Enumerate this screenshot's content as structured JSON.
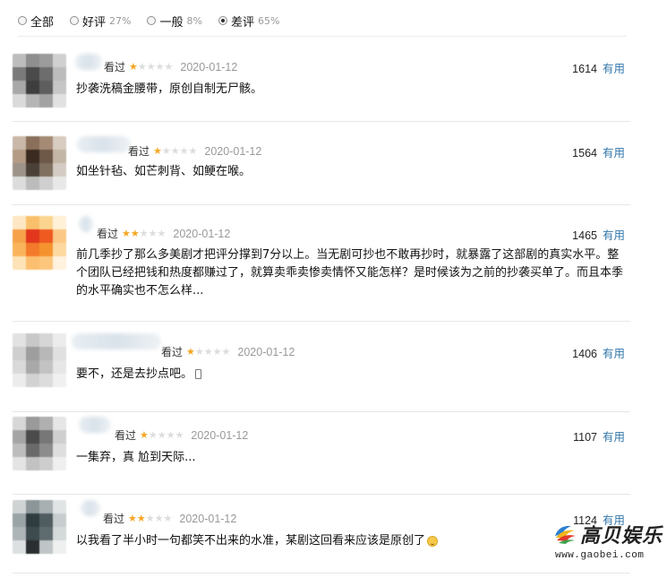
{
  "filters": [
    {
      "label": "全部",
      "pct": "",
      "checked": false
    },
    {
      "label": "好评",
      "pct": "27%",
      "checked": false
    },
    {
      "label": "一般",
      "pct": "8%",
      "checked": false
    },
    {
      "label": "差评",
      "pct": "65%",
      "checked": true
    }
  ],
  "comments": [
    {
      "watched": "看过",
      "stars": 1,
      "date": "2020-01-12",
      "votes": "1614",
      "useful": "有用",
      "text": "抄袭洗稿金腰带，原创自制无尸骸。"
    },
    {
      "watched": "看过",
      "stars": 1,
      "date": "2020-01-12",
      "votes": "1564",
      "useful": "有用",
      "text": "如坐针毡、如芒刺背、如鲠在喉。"
    },
    {
      "watched": "看过",
      "stars": 2,
      "date": "2020-01-12",
      "votes": "1465",
      "useful": "有用",
      "text": "前几季抄了那么多美剧才把评分撑到7分以上。当无剧可抄也不敢再抄时，就暴露了这部剧的真实水平。整个团队已经把钱和热度都赚过了，就算卖乖卖惨卖情怀又能怎样？是时候该为之前的抄袭买单了。而且本季的水平确实也不怎么样..."
    },
    {
      "watched": "看过",
      "stars": 1,
      "date": "2020-01-12",
      "votes": "1406",
      "useful": "有用",
      "text": "要不，还是去抄点吧。",
      "icon": "phone-icon"
    },
    {
      "watched": "看过",
      "stars": 1,
      "date": "2020-01-12",
      "votes": "1107",
      "useful": "有用",
      "text": "一集弃，真 尬到天际..."
    },
    {
      "watched": "看过",
      "stars": 2,
      "date": "2020-01-12",
      "votes": "1124",
      "useful": "有用",
      "text": "以我看了半小时一句都笑不出来的水准，某剧这回看来应该是原创了",
      "icon": "emoji-icon"
    }
  ],
  "watermark": {
    "title": "高贝娱乐",
    "url": "www.gaobei.com"
  },
  "colors": {
    "star": "#f5a623",
    "useful_link": "#3377aa",
    "date": "#999999"
  }
}
